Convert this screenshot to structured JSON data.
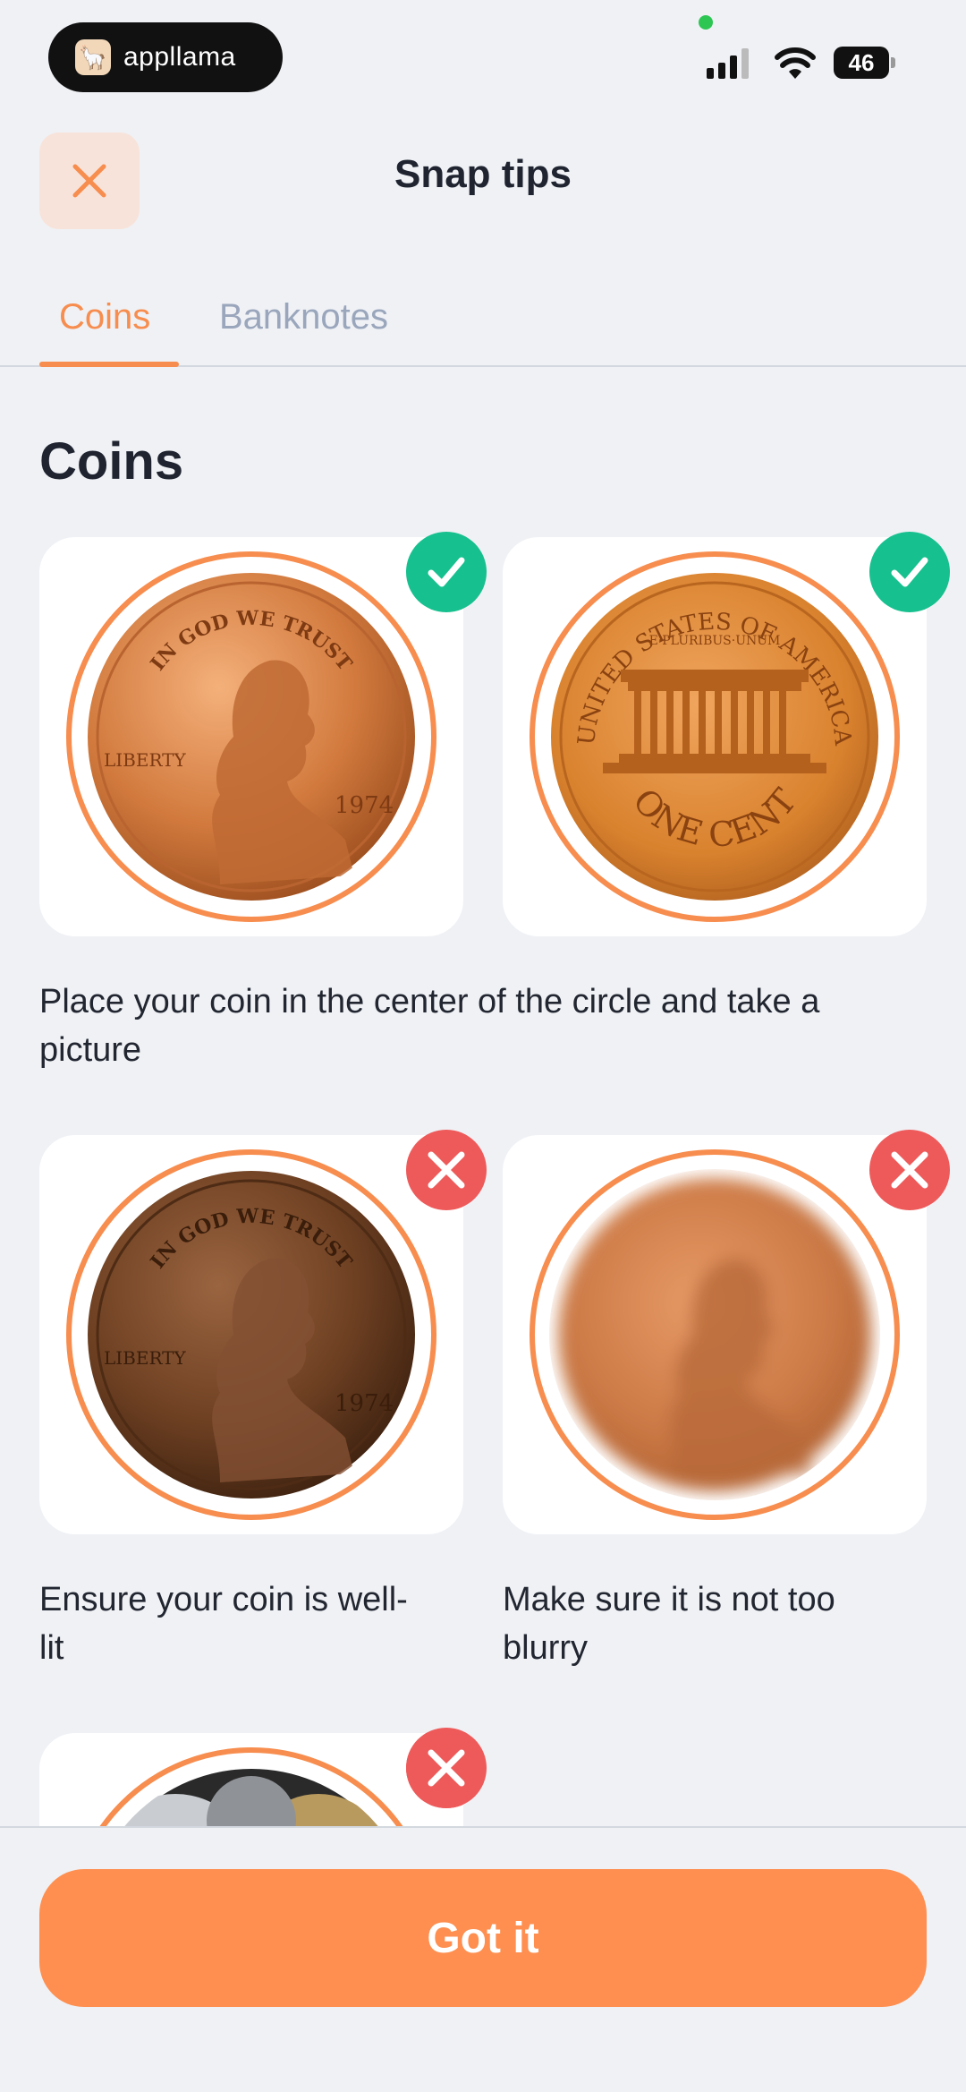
{
  "status_bar": {
    "app_name": "appllama",
    "battery": "46",
    "colors": {
      "dot": "#2DC653"
    }
  },
  "header": {
    "title": "Snap tips",
    "close_icon": "close-icon"
  },
  "tabs": [
    {
      "label": "Coins",
      "active": true
    },
    {
      "label": "Banknotes",
      "active": false
    }
  ],
  "section": {
    "title": "Coins"
  },
  "tips": {
    "good_caption": "Place your coin in the center of the circle and take a picture",
    "lit_caption": "Ensure your coin is well-lit",
    "blur_caption": "Make sure it is not too blurry"
  },
  "coins": {
    "obverse_motto": "IN GOD WE TRUST",
    "obverse_liberty": "LIBERTY",
    "obverse_year": "1974",
    "reverse_top": "UNITED STATES OF AMERICA",
    "reverse_motto": "E·PLURIBUS·UNUM",
    "reverse_bottom": "ONE CENT"
  },
  "footer": {
    "button_label": "Got it"
  },
  "colors": {
    "accent": "#F78D4E",
    "button": "#FE8F50",
    "ok_badge": "#17C08F",
    "bad_badge": "#EE5A5A",
    "background": "#EFF1F5"
  }
}
